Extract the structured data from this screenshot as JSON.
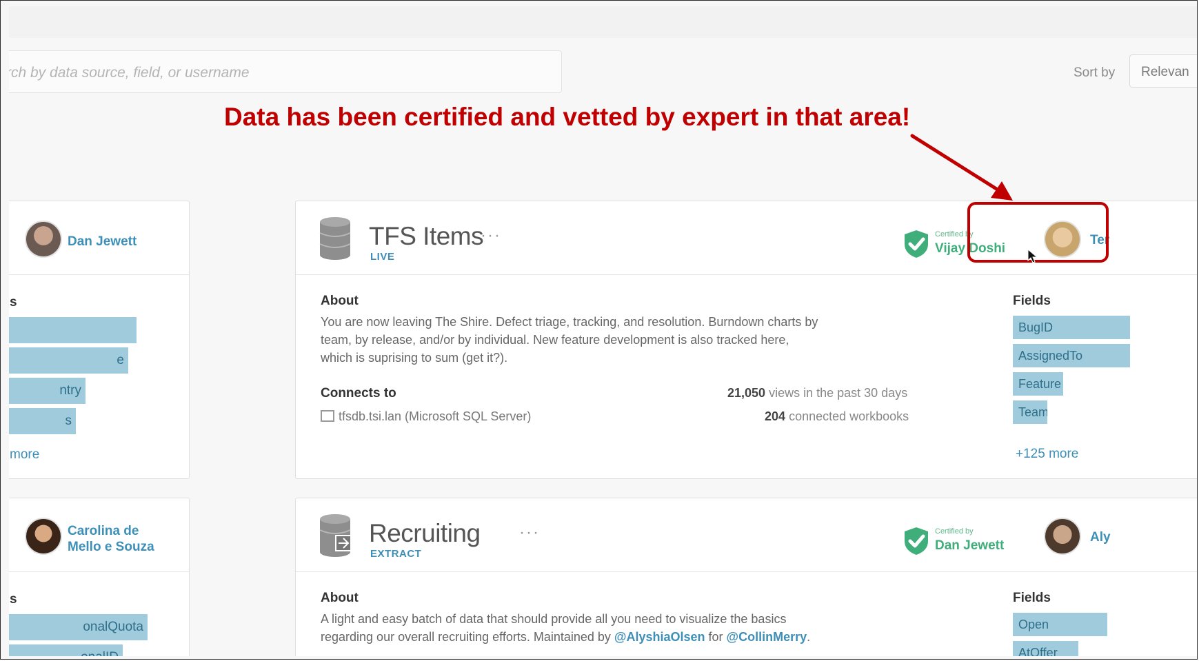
{
  "search": {
    "placeholder": "rch by data source, field, or username"
  },
  "sort": {
    "label": "Sort by",
    "value": "Relevan"
  },
  "annotation": {
    "text": "Data has been certified and vetted by expert in that area!"
  },
  "left_cards": [
    {
      "owner": "Dan Jewett",
      "label_fragment": "s",
      "bars": [
        {
          "label": "",
          "fraction": 0.92
        },
        {
          "label": "e",
          "fraction": 0.86
        },
        {
          "label": "ntry",
          "fraction": 0.55
        },
        {
          "label": "s",
          "fraction": 0.48
        }
      ],
      "more": "more"
    },
    {
      "owner_line1": "Carolina de",
      "owner_line2": "Mello e Souza",
      "label_fragment": "s",
      "bars": [
        {
          "label": "onalQuota",
          "fraction": 1.0
        },
        {
          "label": "onalID",
          "fraction": 0.82
        }
      ]
    }
  ],
  "datasources": [
    {
      "title": "TFS Items",
      "type": "LIVE",
      "menu": "···",
      "certified_small": "Certified by",
      "certified_by": "Vijay Doshi",
      "steward_fragment": "Ter",
      "about_label": "About",
      "about_lines": [
        "You are now leaving The Shire. Defect triage, tracking, and resolution. Burndown charts by",
        "team, by release, and/or by individual. New feature development is also tracked here,",
        "which is suprising to sum (get it?)."
      ],
      "connects_label": "Connects to",
      "connection": "tfsdb.tsi.lan (Microsoft SQL Server)",
      "views_count": "21,050",
      "views_text": "views in the past 30 days",
      "workbooks_count": "204",
      "workbooks_text": "connected workbooks",
      "fields_label": "Fields",
      "fields": [
        {
          "name": "BugID",
          "fraction": 1.0
        },
        {
          "name": "AssignedTo",
          "fraction": 1.0
        },
        {
          "name": "Feature",
          "fraction": 0.35
        },
        {
          "name": "Team",
          "fraction": 0.2
        }
      ],
      "more": "+125 more"
    },
    {
      "title": "Recruiting",
      "type": "EXTRACT",
      "menu": "···",
      "certified_small": "Certified by",
      "certified_by": "Dan Jewett",
      "steward_fragment": "Aly",
      "about_label": "About",
      "about_line1": "A light and easy batch of data that should provide all you need to visualize the basics",
      "about_line2_pre": "regarding our overall recruiting efforts. Maintained by ",
      "mention1": "@AlyshiaOlsen",
      "about_line2_mid": " for ",
      "mention2": "@CollinMerry",
      "about_line2_end": ".",
      "fields_label": "Fields",
      "fields": [
        {
          "name": "Open",
          "fraction": 0.78
        },
        {
          "name": "AtOffer",
          "fraction": 0.5
        }
      ]
    }
  ],
  "colors": {
    "annotation_red": "#c00000",
    "link_blue": "#3d8fb8",
    "cert_green": "#3fae7a",
    "field_bar": "#9fcbdc"
  }
}
